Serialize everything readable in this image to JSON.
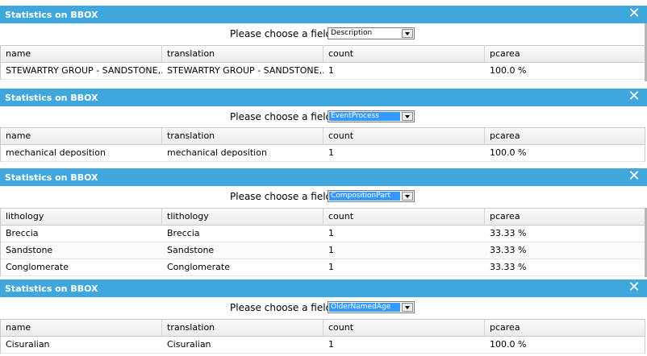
{
  "panels": [
    {
      "title": "Statistics on BBOX",
      "chooser_label": "Please choose a field:",
      "selected_field": "Description",
      "highlighted": false,
      "columns": [
        "name",
        "translation",
        "count",
        "pcarea"
      ],
      "rows": [
        [
          "STEWARTRY GROUP - SANDSTONE,...",
          "STEWARTRY GROUP - SANDSTONE,...",
          "1",
          "100.0 %"
        ]
      ]
    },
    {
      "title": "Statistics on BBOX",
      "chooser_label": "Please choose a field:",
      "selected_field": "EventProcess",
      "highlighted": true,
      "columns": [
        "name",
        "translation",
        "count",
        "pcarea"
      ],
      "rows": [
        [
          "mechanical deposition",
          "mechanical deposition",
          "1",
          "100.0 %"
        ]
      ]
    },
    {
      "title": "Statistics on BBOX",
      "chooser_label": "Please choose a field:",
      "selected_field": "CompositionPart",
      "highlighted": true,
      "columns": [
        "lithology",
        "tlithology",
        "count",
        "pcarea"
      ],
      "rows": [
        [
          "Breccia",
          "Breccia",
          "1",
          "33.33 %"
        ],
        [
          "Sandstone",
          "Sandstone",
          "1",
          "33.33 %"
        ],
        [
          "Conglomerate",
          "Conglomerate",
          "1",
          "33.33 %"
        ]
      ]
    },
    {
      "title": "Statistics on BBOX",
      "chooser_label": "Please choose a field:",
      "selected_field": "OlderNamedAge",
      "highlighted": true,
      "columns": [
        "name",
        "translation",
        "count",
        "pcarea"
      ],
      "rows": [
        [
          "Cisuralian",
          "Cisuralian",
          "1",
          "100.0 %"
        ]
      ]
    }
  ],
  "colors": {
    "titlebar": "#3fa7db",
    "selection": "#3399ff"
  },
  "icons": {
    "close": "close-icon",
    "dropdown": "chevron-down-icon"
  }
}
